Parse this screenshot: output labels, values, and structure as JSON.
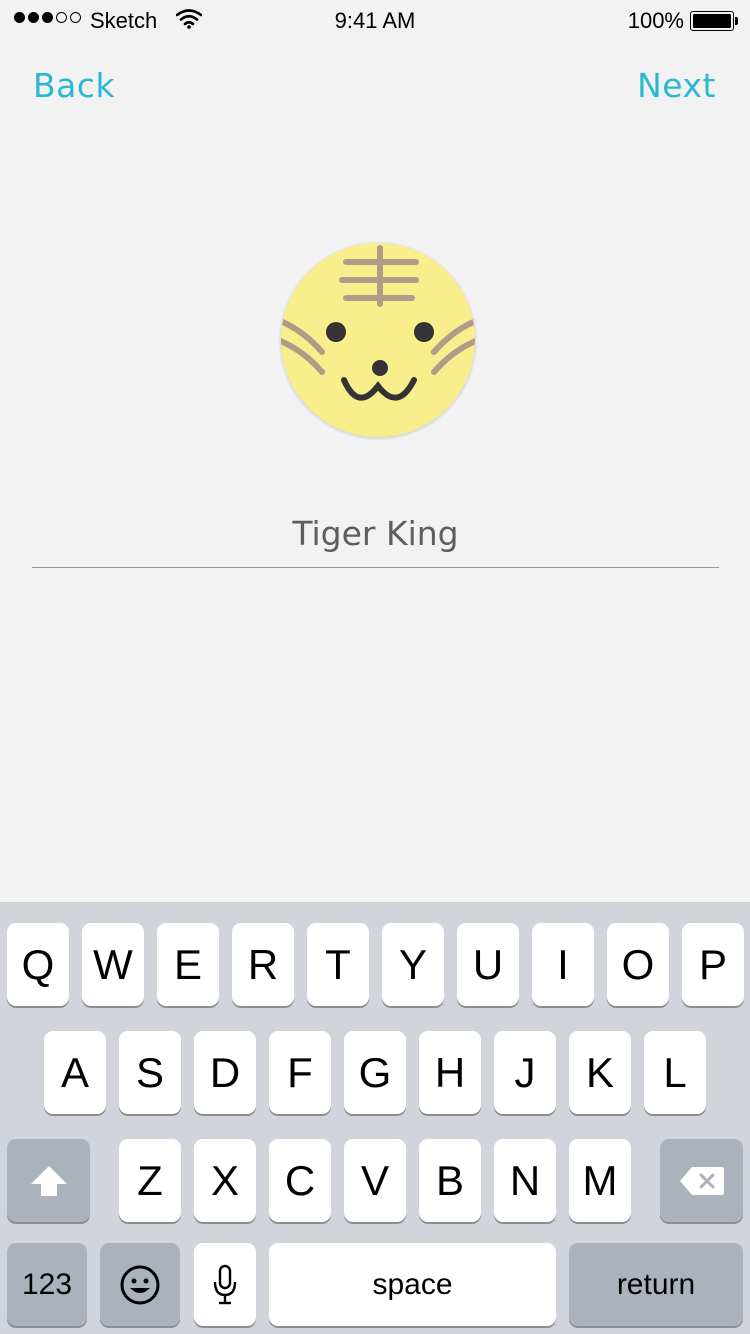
{
  "status_bar": {
    "carrier": "Sketch",
    "time": "9:41 AM",
    "battery": "100%"
  },
  "nav": {
    "back_label": "Back",
    "next_label": "Next"
  },
  "profile": {
    "avatar_icon": "tiger-face-icon",
    "name_value": "Tiger King"
  },
  "keyboard": {
    "row1": [
      "Q",
      "W",
      "E",
      "R",
      "T",
      "Y",
      "U",
      "I",
      "O",
      "P"
    ],
    "row2": [
      "A",
      "S",
      "D",
      "F",
      "G",
      "H",
      "J",
      "K",
      "L"
    ],
    "row3": [
      "Z",
      "X",
      "C",
      "V",
      "B",
      "N",
      "M"
    ],
    "numbers_label": "123",
    "space_label": "space",
    "return_label": "return"
  },
  "colors": {
    "accent": "#2bb8d4",
    "avatar_fill": "#f8ee8c",
    "stripe": "#b39a88",
    "background": "#f2f2f2",
    "keyboard_bg": "#d1d5db"
  }
}
